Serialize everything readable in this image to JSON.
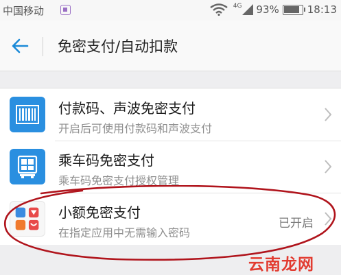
{
  "status_bar": {
    "carrier": "中国移动",
    "network": "4G",
    "battery": "93%",
    "time": "18:13"
  },
  "header": {
    "title": "免密支付/自动扣款"
  },
  "list": [
    {
      "title": "付款码、声波免密支付",
      "subtitle": "开启后可使用付款码和声波支付",
      "status": "",
      "icon": "barcode-icon",
      "icon_color": "#2a8fe0"
    },
    {
      "title": "乘车码免密支付",
      "subtitle": "乘车码免密支付授权管理",
      "status": "",
      "icon": "bus-card-icon",
      "icon_color": "#2a8fe0"
    },
    {
      "title": "小额免密支付",
      "subtitle": "在指定应用中无需输入密码",
      "status": "已开启",
      "icon": "apps-grid-icon",
      "icon_color": "#f7f7f7"
    }
  ],
  "watermark": {
    "text": "云南龙网",
    "color": "#e23b30"
  },
  "colors": {
    "accent": "#1a8ad8",
    "annotation": "#b0141c"
  }
}
